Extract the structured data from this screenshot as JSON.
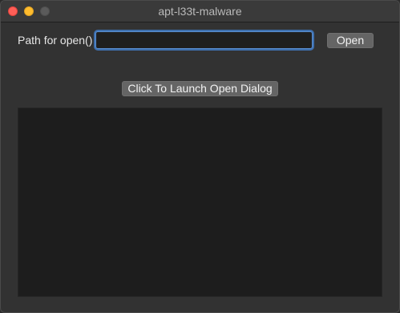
{
  "window": {
    "title": "apt-l33t-malware",
    "traffic_lights": {
      "close_color": "#fe5f57",
      "minimize_color": "#febc2e",
      "zoom_color": "#5b5b5b"
    }
  },
  "form": {
    "path_label": "Path for open()",
    "path_value": "",
    "path_placeholder": "",
    "open_button_label": "Open",
    "launch_button_label": "Click To Launch Open Dialog"
  },
  "output": {
    "text": ""
  },
  "colors": {
    "window_bg": "#323232",
    "focus_ring": "#5a8fd1",
    "button_bg": "#656565",
    "output_bg": "#1d1d1d"
  }
}
